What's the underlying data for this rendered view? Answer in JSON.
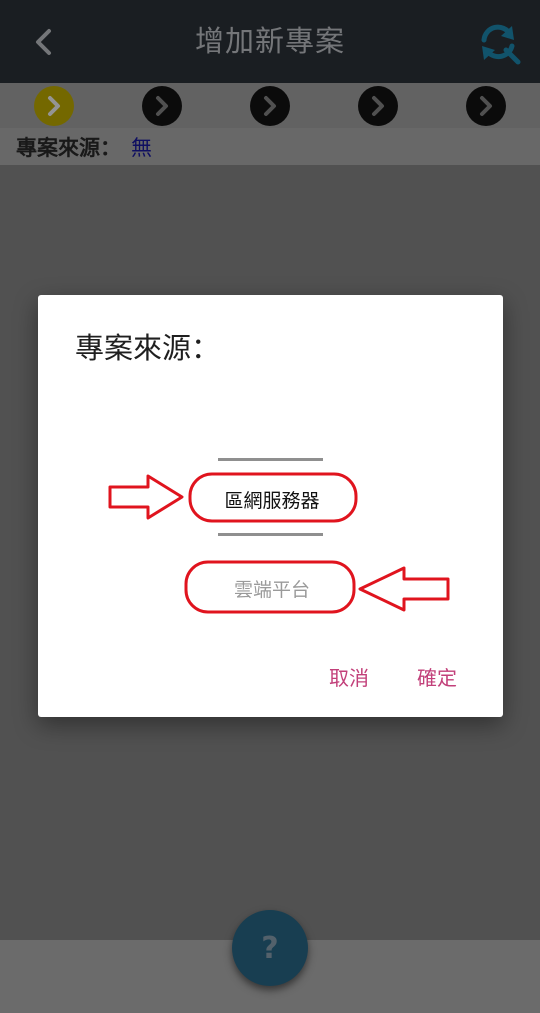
{
  "header": {
    "title": "增加新專案",
    "back_icon": "chevron-left-icon",
    "refresh_icon": "refresh-search-icon",
    "refresh_color": "#1e8fb8"
  },
  "stepper": {
    "steps": [
      {
        "state": "active",
        "icon": "chevron-right-icon"
      },
      {
        "state": "inactive",
        "icon": "chevron-right-icon"
      },
      {
        "state": "inactive",
        "icon": "chevron-right-icon"
      },
      {
        "state": "inactive",
        "icon": "chevron-right-icon"
      },
      {
        "state": "inactive",
        "icon": "chevron-right-icon"
      }
    ],
    "active_color": "#c8b400"
  },
  "source_row": {
    "label": "專案來源：",
    "value": "無"
  },
  "dialog": {
    "title": "專案來源：",
    "options": [
      {
        "label": "區網服務器",
        "selected": true
      },
      {
        "label": "雲端平台",
        "selected": false
      }
    ],
    "cancel_label": "取消",
    "confirm_label": "確定",
    "action_color": "#c2407a"
  },
  "help_button": {
    "label": "?",
    "color": "#2a6b8c"
  },
  "annotations": {
    "color": "#e0141e"
  }
}
